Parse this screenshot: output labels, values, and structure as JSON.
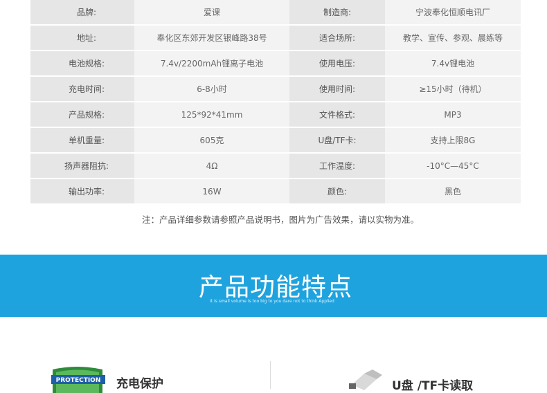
{
  "specs": [
    {
      "k1": "品牌:",
      "v1": "爱课",
      "k2": "制造商:",
      "v2": "宁波奉化恒顺电讯厂"
    },
    {
      "k1": "地址:",
      "v1": "奉化区东郊开发区银峰路38号",
      "k2": "适合场所:",
      "v2": "教学、宣传、参观、晨练等"
    },
    {
      "k1": "电池规格:",
      "v1": "7.4v/2200mAh锂离子电池",
      "k2": "使用电压:",
      "v2": "7.4v锂电池"
    },
    {
      "k1": "充电时间:",
      "v1": "6-8小时",
      "k2": "使用时间:",
      "v2": "≥15小时（待机）"
    },
    {
      "k1": "产品规格:",
      "v1": "125*92*41mm",
      "k2": "文件格式:",
      "v2": "MP3"
    },
    {
      "k1": "单机重量:",
      "v1": "605克",
      "k2": "U盘/TF卡:",
      "v2": "支持上限8G"
    },
    {
      "k1": "扬声器阻抗:",
      "v1": "4Ω",
      "k2": "工作温度:",
      "v2": "-10°C—45°C"
    },
    {
      "k1": "输出功率:",
      "v1": "16W",
      "k2": "颜色:",
      "v2": "黑色"
    }
  ],
  "note": "注：产品详细参数请参照产品说明书，图片为广告效果，请以实物为准。",
  "banner": {
    "title": "产品功能特点",
    "subtitle": "It is small volume is too big to you dare not to think Applied",
    "color": "#1ea3df"
  },
  "features": {
    "left": {
      "badge_text": "PROTECTION",
      "title": "充电保护",
      "icon": "shield-icon"
    },
    "right": {
      "title": "U盘 /TF卡读取",
      "icon": "udisk-icon"
    }
  }
}
